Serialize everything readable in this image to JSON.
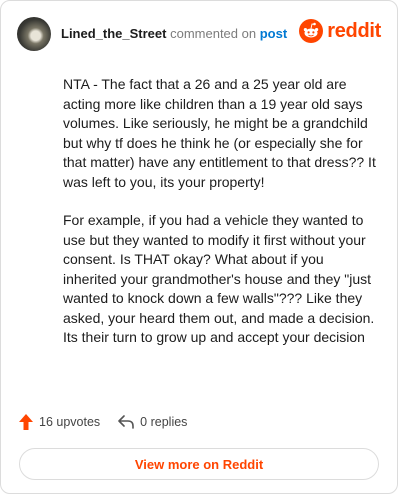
{
  "header": {
    "username": "Lined_the_Street",
    "commented_text": " commented on ",
    "post_link": "post",
    "brand": "reddit"
  },
  "comment": {
    "paragraphs": [
      "NTA - The fact that a 26 and a 25 year old are acting more like children than a 19 year old says volumes. Like seriously, he might be a grandchild but why tf does he think he (or especially she for that matter) have any entitlement to that dress?? It was left to you, its your property!",
      "For example, if you had a vehicle they wanted to use but they wanted to modify it first without your consent. Is THAT okay? What about if you inherited your grandmother's house and they \"just wanted to knock down a few walls\"??? Like they asked, your heard them out, and made a decision. Its their turn to grow up and accept your decision"
    ]
  },
  "footer": {
    "upvotes": "16 upvotes",
    "replies": "0 replies",
    "view_more": "View more on Reddit"
  },
  "colors": {
    "brand": "#ff4500",
    "link": "#0079d3"
  }
}
